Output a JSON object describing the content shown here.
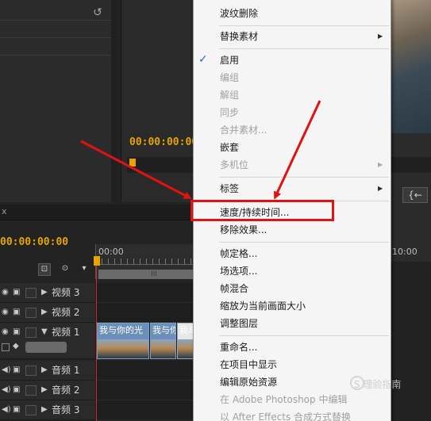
{
  "monitor": {
    "timecode": "00:00:00:00"
  },
  "timeline": {
    "timecode": "00:00:00:00",
    "ruler_start": "00:00",
    "ruler_end": "10:00",
    "workbar_grip": "III",
    "tab_close": "x",
    "tracks": [
      {
        "label": "视频 3",
        "kind": "video"
      },
      {
        "label": "视频 2",
        "kind": "video"
      },
      {
        "label": "视频 1",
        "kind": "video"
      },
      {
        "label": "音频 1",
        "kind": "audio"
      },
      {
        "label": "音频 2",
        "kind": "audio"
      },
      {
        "label": "音频 3",
        "kind": "audio"
      }
    ],
    "clips": [
      "我与你的光",
      "我与你",
      "我与"
    ]
  },
  "context_menu": {
    "items": [
      {
        "label": "波纹删除"
      },
      {
        "label": "替换素材",
        "submenu": true
      },
      {
        "label": "启用",
        "checked": true
      },
      {
        "label": "编组",
        "disabled": true
      },
      {
        "label": "解组",
        "disabled": true
      },
      {
        "label": "同步",
        "disabled": true
      },
      {
        "label": "合并素材...",
        "disabled": true
      },
      {
        "label": "嵌套"
      },
      {
        "label": "多机位",
        "disabled": true,
        "submenu": true
      },
      {
        "label": "标签",
        "submenu": true
      },
      {
        "label": "速度/持续时间...",
        "highlighted": true
      },
      {
        "label": "移除效果..."
      },
      {
        "label": "帧定格..."
      },
      {
        "label": "场选项..."
      },
      {
        "label": "帧混合"
      },
      {
        "label": "缩放为当前画面大小"
      },
      {
        "label": "调整图层"
      },
      {
        "label": "重命名..."
      },
      {
        "label": "在项目中显示"
      },
      {
        "label": "编辑原始资源"
      },
      {
        "label": "在 Adobe Photoshop 中编辑",
        "disabled": true
      },
      {
        "label": "以 After Effects 合成方式替换",
        "disabled": true
      }
    ]
  },
  "watermark": "S 理验指南",
  "colors": {
    "timecode": "#e6a400",
    "annotation_red": "#e01212",
    "menu_bg": "#f5f5f5",
    "check": "#2a5fd0"
  },
  "icons": [
    "undo-icon",
    "eye-icon",
    "film-icon",
    "speaker-icon",
    "check-icon",
    "submenu-arrow-icon"
  ]
}
